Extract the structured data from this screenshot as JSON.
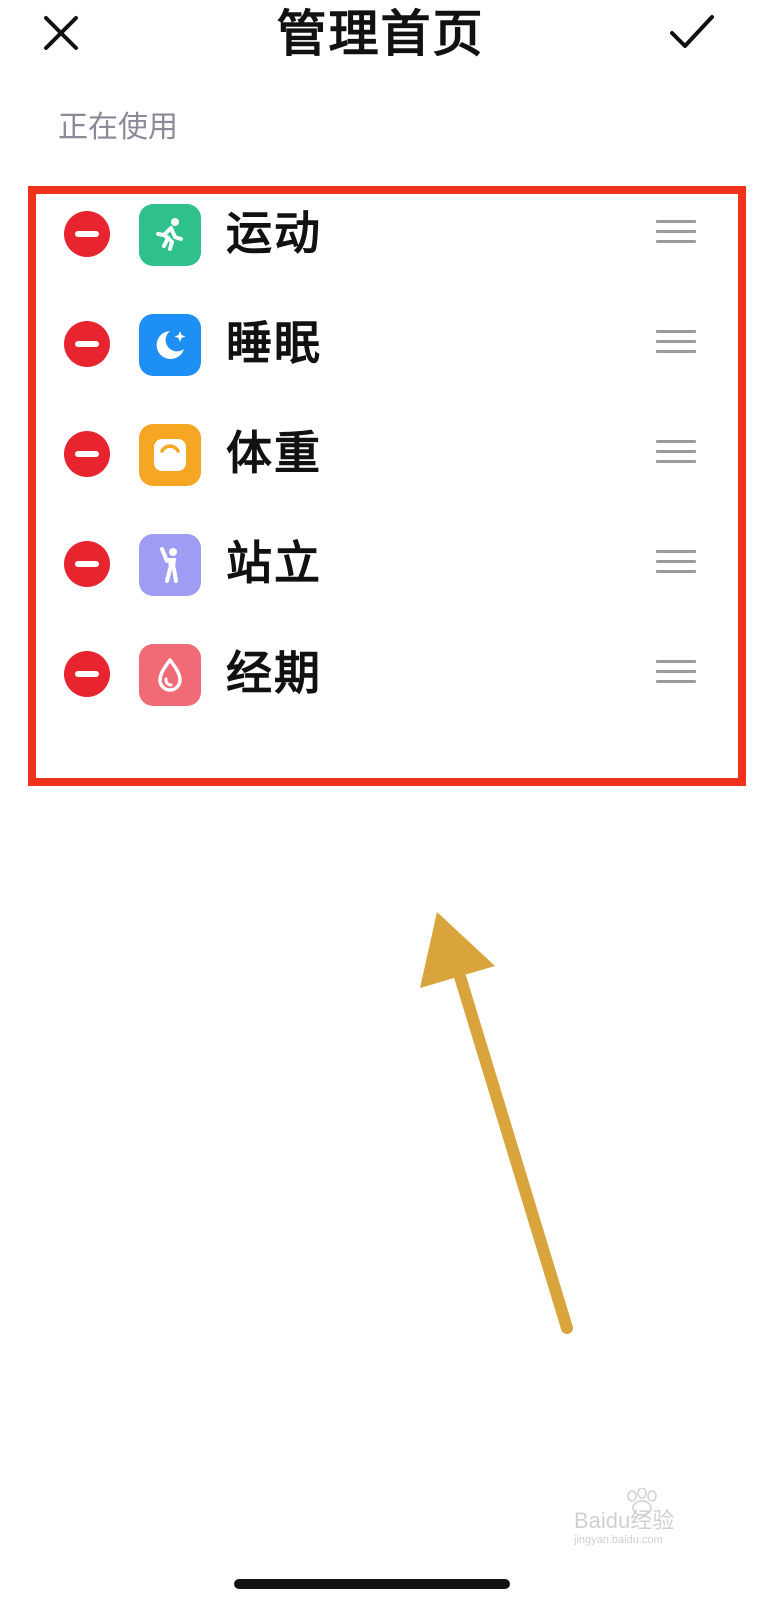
{
  "header": {
    "title": "管理首页",
    "close_icon": "close-icon",
    "confirm_icon": "checkmark-icon"
  },
  "section": {
    "label": "正在使用"
  },
  "items": [
    {
      "label": "运动",
      "icon": "running-icon",
      "icon_color": "#2ec18b"
    },
    {
      "label": "睡眠",
      "icon": "moon-star-icon",
      "icon_color": "#1e90f5"
    },
    {
      "label": "体重",
      "icon": "scale-icon",
      "icon_color": "#f5a623"
    },
    {
      "label": "站立",
      "icon": "standing-person-icon",
      "icon_color": "#9f9cf3"
    },
    {
      "label": "经期",
      "icon": "drop-icon",
      "icon_color": "#f06b76"
    }
  ],
  "annotation": {
    "highlight_color": "#f0311c",
    "arrow_color": "#d9a43c"
  },
  "watermark": {
    "text": "Baidu经验",
    "subtext": "jingyan.baidu.com"
  }
}
